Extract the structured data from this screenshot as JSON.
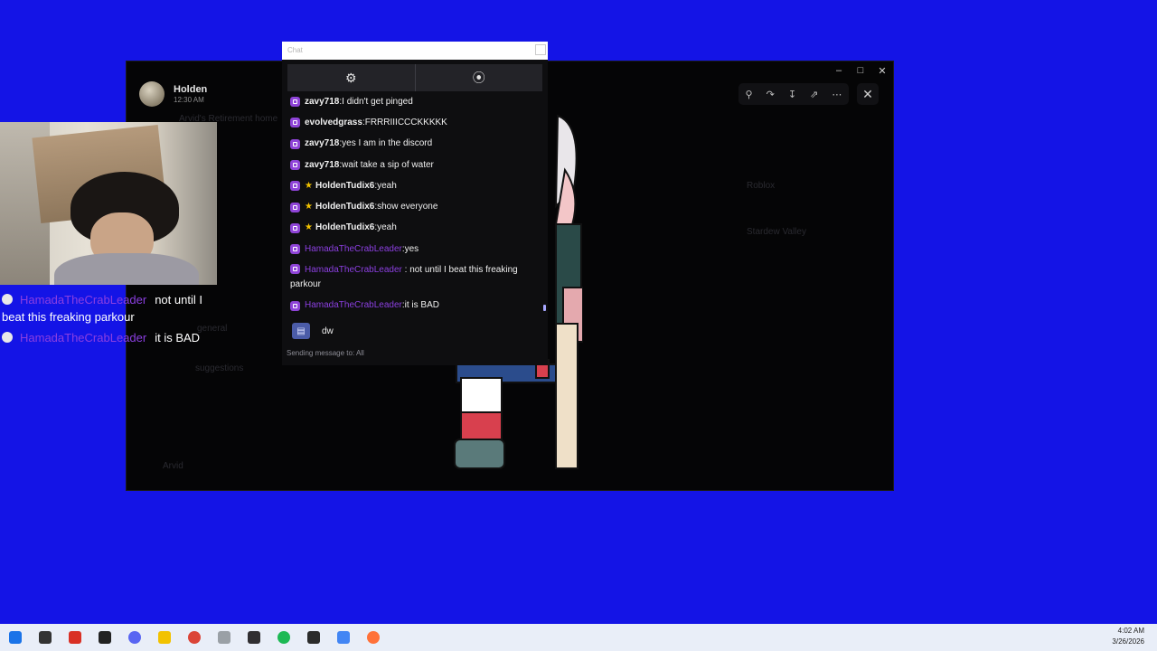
{
  "viewer": {
    "user_name": "Holden",
    "user_time": "12:30 AM",
    "faint_text": [
      {
        "text": "Arvid's Retirement home"
      },
      {
        "text": "general"
      },
      {
        "text": "suggestions"
      },
      {
        "text": "Arvid"
      },
      {
        "text": "Roblox"
      },
      {
        "text": "Stardew Valley"
      }
    ],
    "toolbar_icons": [
      "zoom-icon",
      "forward-icon",
      "download-icon",
      "open-external-icon",
      "more-icon"
    ]
  },
  "chat": {
    "window_title": "Chat",
    "toolbar": [
      "settings-icon",
      "popout-icon"
    ],
    "messages": [
      {
        "user": "zavy718",
        "text": "I didn't get pinged",
        "badge": "",
        "color": "default"
      },
      {
        "user": "evolvedgrass",
        "text": "FRRRIIICCCKKKKK",
        "badge": "",
        "color": "default"
      },
      {
        "user": "zavy718",
        "text": "yes I am in the discord",
        "badge": "",
        "color": "default"
      },
      {
        "user": "zavy718",
        "text": "wait take a sip of water",
        "badge": "",
        "color": "default"
      },
      {
        "user": "HoldenTudix6",
        "text": "yeah",
        "badge": "star",
        "color": "default"
      },
      {
        "user": "HoldenTudix6",
        "text": "show everyone",
        "badge": "star",
        "color": "default"
      },
      {
        "user": "HoldenTudix6",
        "text": "yeah",
        "badge": "star",
        "color": "default"
      },
      {
        "user": "HamadaTheCrabLeader",
        "text": "yes",
        "badge": "",
        "color": "purple"
      },
      {
        "user": "HamadaTheCrabLeader",
        "text": "not until I beat this freaking parkour",
        "badge": "",
        "color": "purple"
      },
      {
        "user": "HamadaTheCrabLeader",
        "text": "it is BAD",
        "badge": "",
        "color": "purple"
      }
    ],
    "input_value": "dw",
    "footer": "Sending message to: All",
    "separator": " : "
  },
  "overlay": [
    {
      "user": "HamadaTheCrabLeader",
      "text": "not until I",
      "icon": "skull-icon"
    },
    {
      "user": "",
      "text": "beat this freaking parkour",
      "icon": ""
    },
    {
      "user": "HamadaTheCrabLeader",
      "text": "it is BAD",
      "icon": "skull-icon"
    }
  ],
  "taskbar": {
    "apps": [
      {
        "name": "windows-start-icon",
        "color": "#1a73e8"
      },
      {
        "name": "search-icon",
        "color": "#333333"
      },
      {
        "name": "app-red-icon",
        "color": "#d93025"
      },
      {
        "name": "media-icon",
        "color": "#222222"
      },
      {
        "name": "discord-icon",
        "color": "#5865f2"
      },
      {
        "name": "folder-icon",
        "color": "#f2c200"
      },
      {
        "name": "chrome-icon",
        "color": "#db4437"
      },
      {
        "name": "app-gray-icon",
        "color": "#9aa0a6"
      },
      {
        "name": "obs-icon",
        "color": "#302e31"
      },
      {
        "name": "spotify-icon",
        "color": "#1db954"
      },
      {
        "name": "terminal-icon",
        "color": "#2b2b2b"
      },
      {
        "name": "app-multicolor-icon",
        "color": "#4285f4"
      },
      {
        "name": "firefox-icon",
        "color": "#ff7139"
      }
    ],
    "time": "4:02 AM",
    "date": "3/26/2026"
  },
  "colors": {
    "desktop": "#1414e6",
    "twitch_badge": "#8f44d8",
    "purple_name": "#8b3fe0",
    "star": "#f2c200"
  }
}
